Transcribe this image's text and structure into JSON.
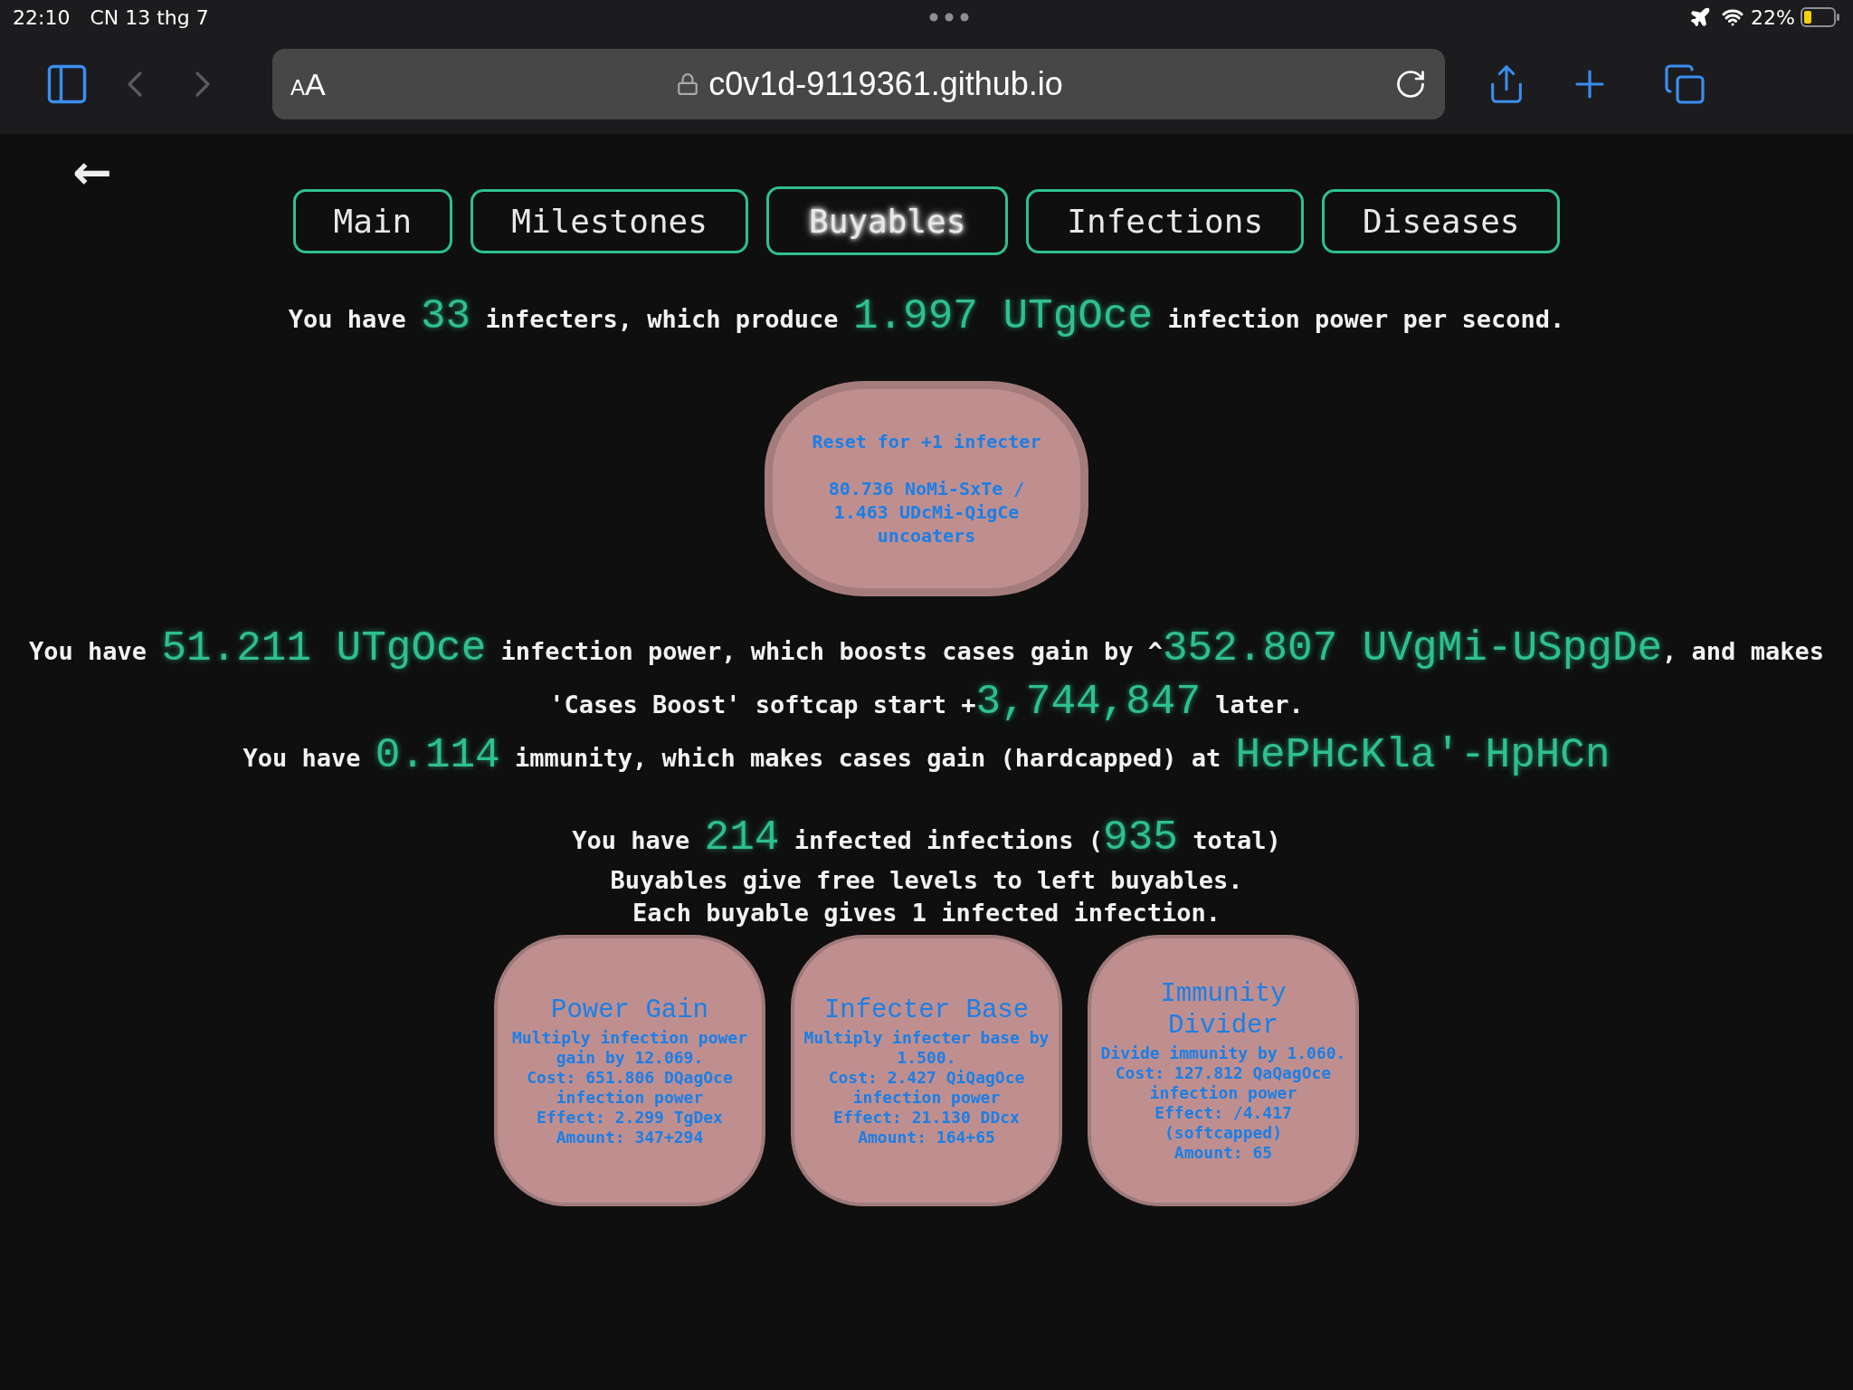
{
  "status_bar": {
    "time": "22:10",
    "date": "CN 13 thg 7",
    "battery": "22%"
  },
  "browser": {
    "reader_button": "AA",
    "url": "c0v1d-9119361.github.io",
    "can_go_back": false,
    "can_go_forward": false
  },
  "page": {
    "back_link": "←",
    "tabs": [
      {
        "label": "Main",
        "selected": false
      },
      {
        "label": "Milestones",
        "selected": false
      },
      {
        "label": "Buyables",
        "selected": true
      },
      {
        "label": "Infections",
        "selected": false
      },
      {
        "label": "Diseases",
        "selected": false
      }
    ],
    "production": [
      {
        "text": "You have ",
        "kind": "plain"
      },
      {
        "text": "33",
        "kind": "number"
      },
      {
        "text": " infecters, which produce ",
        "kind": "plain"
      },
      {
        "text": "1.997 UTgOce",
        "kind": "number"
      },
      {
        "text": " infection power per second.",
        "kind": "plain"
      }
    ],
    "reset_button": {
      "title": "Reset for +1 infecter",
      "cost": "80.736 NoMi-SxTe / 1.463 UDcMi-QigCe uncoaters"
    },
    "stats": [
      [
        {
          "text": "You have ",
          "kind": "plain"
        },
        {
          "text": "51.211 UTgOce",
          "kind": "number"
        },
        {
          "text": " infection power, which boosts cases gain by ^",
          "kind": "plain"
        },
        {
          "text": "352.807 UVgMi-USpgDe",
          "kind": "number"
        },
        {
          "text": ", and makes 'Cases Boost' softcap start +",
          "kind": "plain"
        },
        {
          "text": "3,744,847",
          "kind": "number"
        },
        {
          "text": " later.",
          "kind": "plain"
        }
      ],
      [
        {
          "text": "You have ",
          "kind": "plain"
        },
        {
          "text": "0.114",
          "kind": "number"
        },
        {
          "text": " immunity, which makes cases gain (hardcapped) at ",
          "kind": "plain"
        },
        {
          "text": "HePHcKla'-HpHCn",
          "kind": "number"
        }
      ]
    ],
    "infections": [
      [
        {
          "text": "You have ",
          "kind": "plain"
        },
        {
          "text": "214",
          "kind": "number"
        },
        {
          "text": " infected infections (",
          "kind": "plain"
        },
        {
          "text": "935",
          "kind": "number"
        },
        {
          "text": " total)",
          "kind": "plain"
        }
      ],
      [
        {
          "text": "Buyables give free levels to left buyables.",
          "kind": "plain"
        }
      ],
      [
        {
          "text": "Each buyable gives 1 infected infection.",
          "kind": "plain"
        }
      ]
    ],
    "buyables": [
      {
        "title": "Power Gain",
        "description": "Multiply infection power gain by 12.069.",
        "cost": "Cost: 651.806 DQagOce infection power",
        "effect": "Effect: 2.299 TgDex",
        "amount": "Amount: 347+294"
      },
      {
        "title": "Infecter Base",
        "description": "Multiply infecter base by 1.500.",
        "cost": "Cost: 2.427 QiQagOce infection power",
        "effect": "Effect: 21.130 DDcx",
        "amount": "Amount: 164+65"
      },
      {
        "title": "Immunity Divider",
        "description": "Divide immunity by 1.060.",
        "cost": "Cost: 127.812 QaQagOce infection power",
        "effect": "Effect: /4.417 (softcapped)",
        "amount": "Amount: 65"
      }
    ]
  }
}
